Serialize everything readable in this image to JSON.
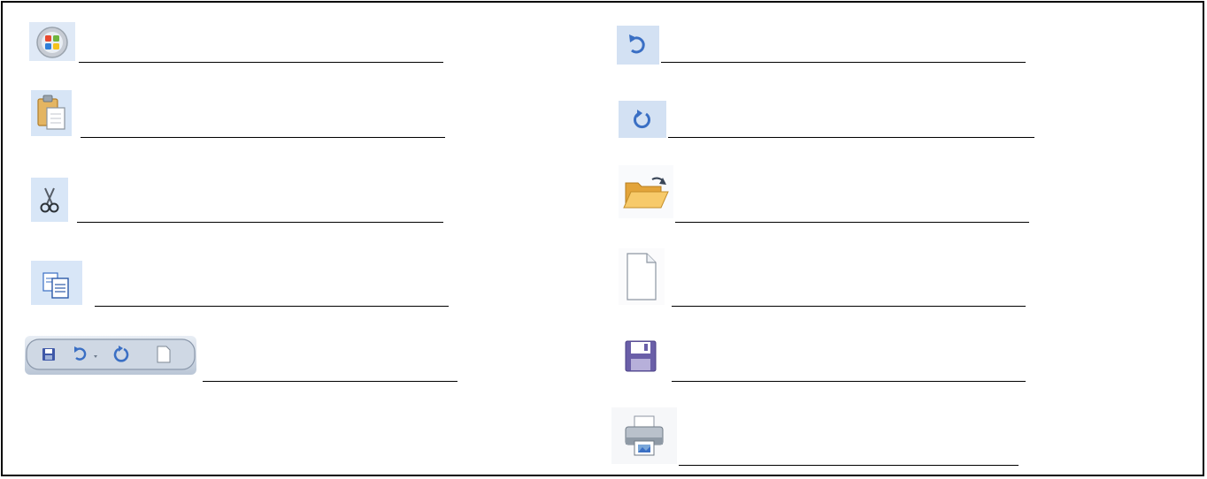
{
  "worksheet": {
    "items": [
      {
        "icon": "office-button-icon",
        "answer": ""
      },
      {
        "icon": "paste-icon",
        "answer": ""
      },
      {
        "icon": "cut-scissors-icon",
        "answer": ""
      },
      {
        "icon": "copy-icon",
        "answer": ""
      },
      {
        "icon": "quick-access-toolbar-icon",
        "answer": ""
      },
      {
        "icon": "undo-icon",
        "answer": ""
      },
      {
        "icon": "redo-icon",
        "answer": ""
      },
      {
        "icon": "open-folder-icon",
        "answer": ""
      },
      {
        "icon": "new-document-icon",
        "answer": ""
      },
      {
        "icon": "save-floppy-icon",
        "answer": ""
      },
      {
        "icon": "print-icon",
        "answer": ""
      }
    ]
  },
  "colors": {
    "border": "#000000",
    "icon_tile_bg": "#d6e4f5",
    "folder": "#f2b84a",
    "floppy": "#6a5fa8",
    "arrow_blue": "#3a6fc4"
  }
}
